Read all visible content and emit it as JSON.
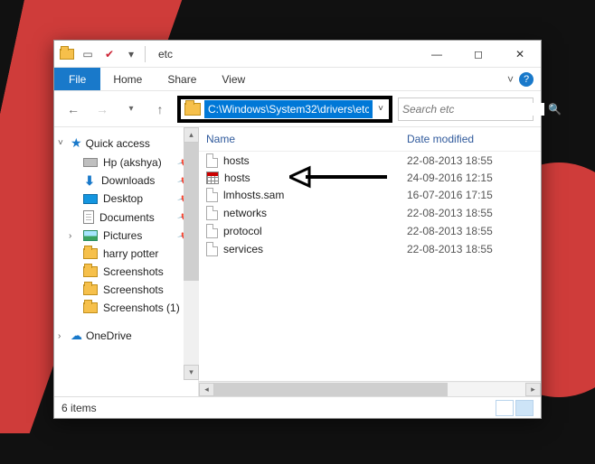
{
  "window": {
    "title": "etc"
  },
  "menu": {
    "file": "File",
    "home": "Home",
    "share": "Share",
    "view": "View",
    "expand": "˅",
    "help": "?"
  },
  "nav": {
    "address": "C:\\Windows\\System32\\drivers\\etc",
    "search_placeholder": "Search etc"
  },
  "sidebar": {
    "quick_access": "Quick access",
    "items": [
      {
        "label": "Hp (akshya)",
        "icon": "laptop",
        "pin": true
      },
      {
        "label": "Downloads",
        "icon": "down",
        "pin": true
      },
      {
        "label": "Desktop",
        "icon": "desktop",
        "pin": true
      },
      {
        "label": "Documents",
        "icon": "doc",
        "pin": true
      },
      {
        "label": "Pictures",
        "icon": "pic",
        "pin": true
      },
      {
        "label": "harry potter",
        "icon": "folder",
        "pin": false
      },
      {
        "label": "Screenshots",
        "icon": "folder",
        "pin": false
      },
      {
        "label": "Screenshots",
        "icon": "folder",
        "pin": false
      },
      {
        "label": "Screenshots (1)",
        "icon": "folder",
        "pin": false
      }
    ],
    "onedrive": "OneDrive"
  },
  "columns": {
    "name": "Name",
    "date": "Date modified"
  },
  "files": [
    {
      "name": "hosts",
      "date": "22-08-2013 18:55",
      "icon": "file"
    },
    {
      "name": "hosts",
      "date": "24-09-2016 12:15",
      "icon": "grid"
    },
    {
      "name": "lmhosts.sam",
      "date": "16-07-2016 17:15",
      "icon": "file"
    },
    {
      "name": "networks",
      "date": "22-08-2013 18:55",
      "icon": "file"
    },
    {
      "name": "protocol",
      "date": "22-08-2013 18:55",
      "icon": "file"
    },
    {
      "name": "services",
      "date": "22-08-2013 18:55",
      "icon": "file"
    }
  ],
  "status": {
    "count": "6 items"
  }
}
